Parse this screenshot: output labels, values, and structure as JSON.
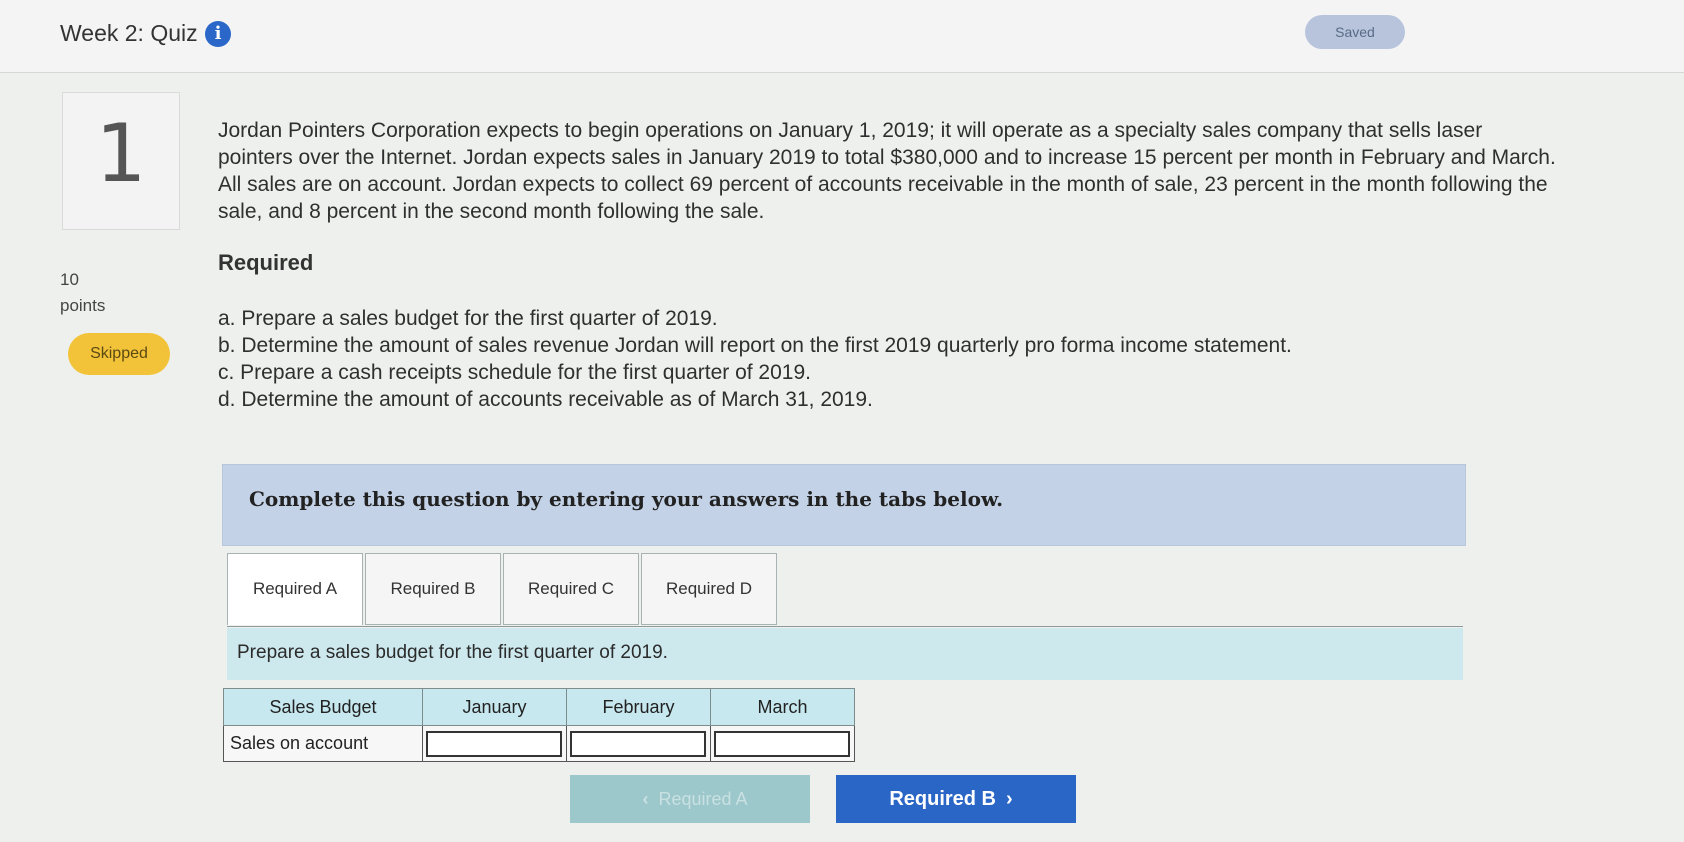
{
  "header": {
    "quiz_title": "Week 2: Quiz",
    "info_icon": "i",
    "saved_status": "Saved"
  },
  "question": {
    "number": "1",
    "points_value": "10",
    "points_label": "points",
    "status": "Skipped",
    "text": "Jordan Pointers Corporation expects to begin operations on January 1, 2019; it will operate as a specialty sales company that sells laser pointers over the Internet. Jordan expects sales in January 2019 to total $380,000 and to increase 15 percent per month in February and March. All sales are on account. Jordan expects to collect 69 percent of accounts receivable in the month of sale, 23 percent in the month following the sale, and 8 percent in the second month following the sale.",
    "required_heading": "Required",
    "requirements": [
      "a. Prepare a sales budget for the first quarter of 2019.",
      "b. Determine the amount of sales revenue Jordan will report on the first 2019 quarterly pro forma income statement.",
      "c. Prepare a cash receipts schedule for the first quarter of 2019.",
      "d. Determine the amount of accounts receivable as of March 31, 2019."
    ]
  },
  "instructions": "Complete this question by entering your answers in the tabs below.",
  "tabs": [
    "Required A",
    "Required B",
    "Required C",
    "Required D"
  ],
  "active_tab": "Required A",
  "prompt": "Prepare a sales budget for the first quarter of 2019.",
  "sales_budget_table": {
    "headers": [
      "Sales Budget",
      "January",
      "February",
      "March"
    ],
    "row_label": "Sales on account",
    "values": [
      "",
      "",
      ""
    ]
  },
  "navigation": {
    "prev_label": "Required A",
    "next_label": "Required B",
    "prev_icon": "chevron-left-icon",
    "next_icon": "chevron-right-icon"
  },
  "colors": {
    "accent": "#2a66c6",
    "skipped": "#f2c339",
    "saved": "#b7c4db",
    "instructions_bg": "#c3d2e6",
    "table_header_bg": "#c6e8ee"
  }
}
